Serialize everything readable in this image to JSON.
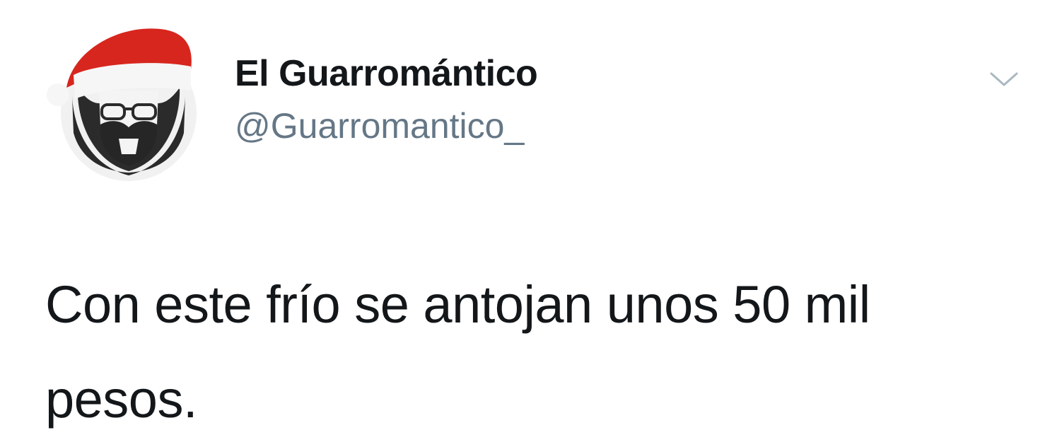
{
  "tweet": {
    "author": {
      "display_name": "El Guarromántico",
      "handle": "@Guarromantico_",
      "avatar_icon": "santa-hat-bearded-man-avatar"
    },
    "menu_icon": "chevron-down-icon",
    "text": "Con este frío se antojan unos 50 mil pesos."
  },
  "colors": {
    "text_primary": "#14171a",
    "text_secondary": "#657786",
    "hat_red": "#d7261e",
    "background": "#ffffff"
  }
}
